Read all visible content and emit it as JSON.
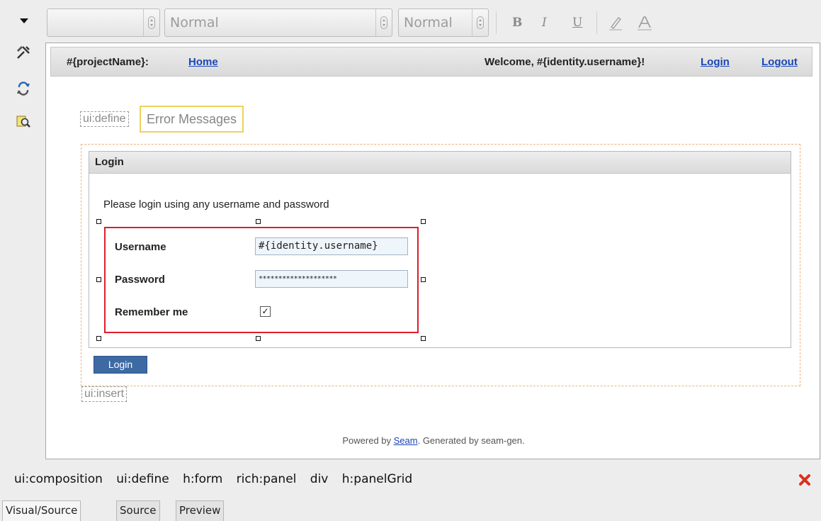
{
  "toolbar": {
    "style_value": "",
    "format_value": "Normal",
    "size_value": "Normal",
    "bold_label": "B",
    "italic_label": "I",
    "underline_label": "U",
    "icons": [
      "collapse-arrow-icon",
      "bold-icon",
      "italic-icon",
      "underline-icon",
      "highlight-icon",
      "text-color-icon"
    ]
  },
  "palette": {
    "icons": [
      "tools-icon",
      "refresh-icon",
      "preview-search-icon"
    ]
  },
  "canvas": {
    "header": {
      "project": "#{projectName}:",
      "home": "Home",
      "welcome": "Welcome, #{identity.username}!",
      "login": "Login",
      "logout": "Logout"
    },
    "define_tag": "ui:define",
    "error_messages": "Error Messages",
    "panel": {
      "title": "Login",
      "description": "Please login using any username and password",
      "fields": [
        {
          "label": "Username",
          "value": "#{identity.username}"
        },
        {
          "label": "Password",
          "value": "********************"
        },
        {
          "label": "Remember me",
          "checked": true
        }
      ]
    },
    "login_button": "Login",
    "insert_tag": "ui:insert",
    "footer": {
      "prefix": "Powered by ",
      "link": "Seam",
      "suffix": ". Generated by seam-gen."
    }
  },
  "breadcrumb": [
    "ui:composition",
    "ui:define",
    "h:form",
    "rich:panel",
    "div",
    "h:panelGrid"
  ],
  "tabs": [
    {
      "label": "Visual/Source",
      "active": true
    },
    {
      "label": "Source",
      "active": false
    },
    {
      "label": "Preview",
      "active": false
    }
  ],
  "colors": {
    "selection": "#dc1f2a",
    "link": "#1b47b5",
    "button": "#3e6aa4",
    "error_outline": "#f0d25a",
    "form_outline": "#f2b27a"
  }
}
